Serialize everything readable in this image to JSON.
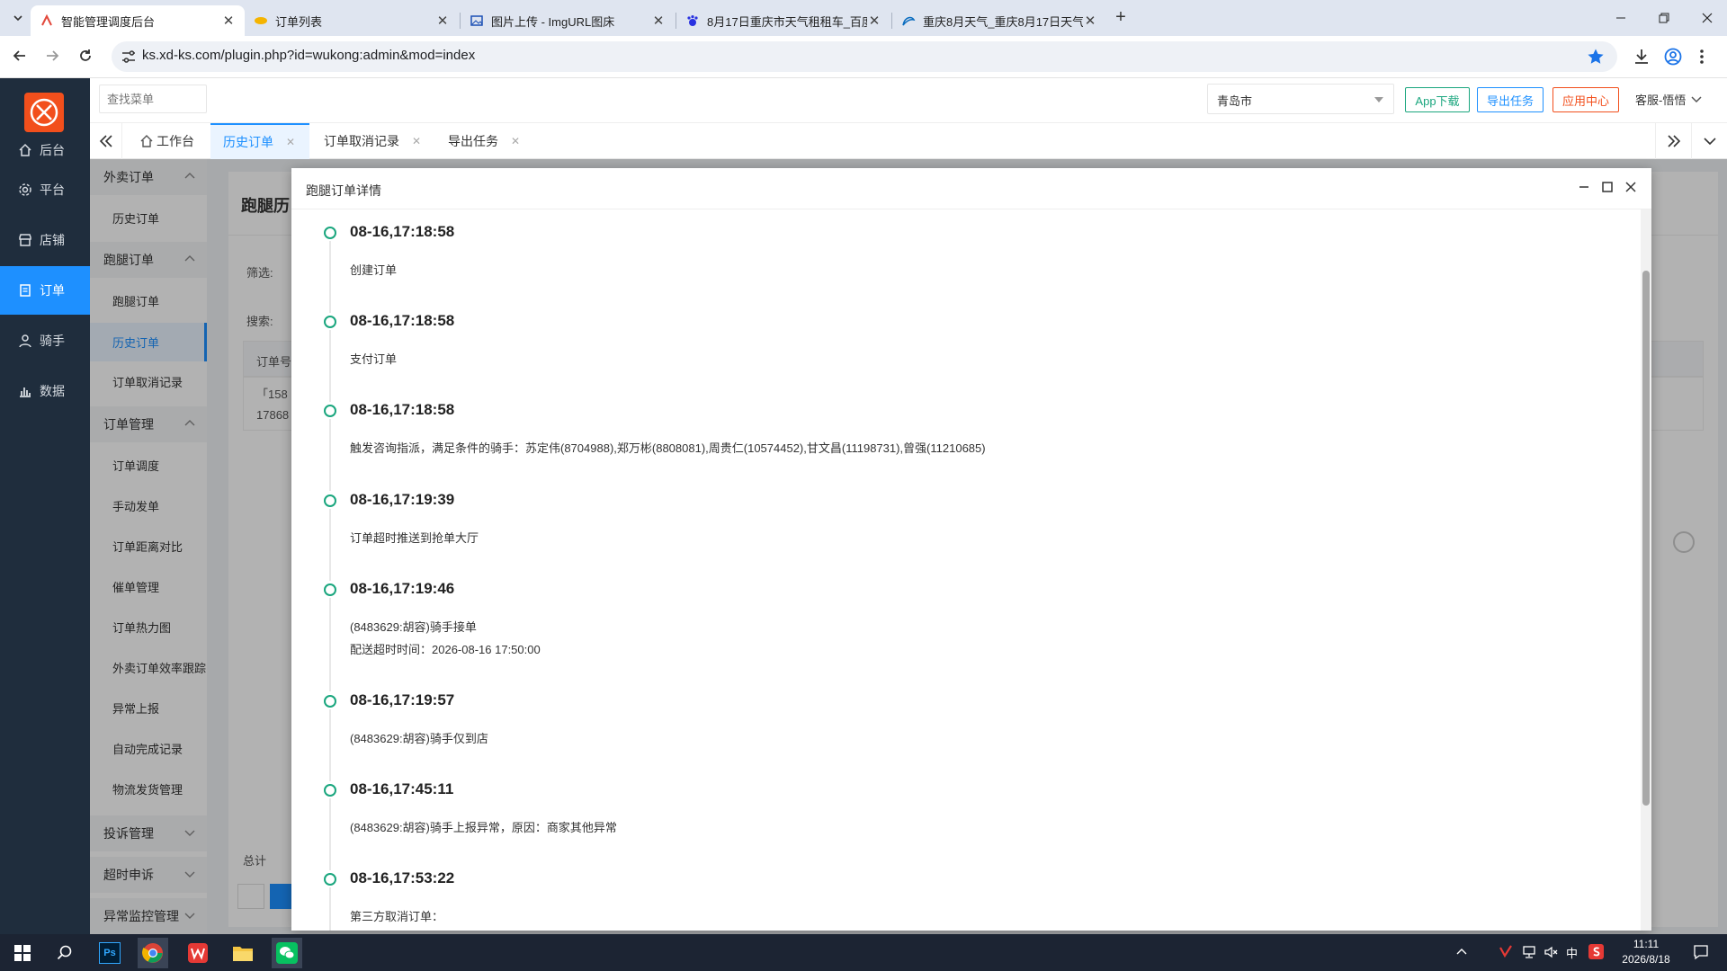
{
  "browser": {
    "tabs": [
      {
        "title": "智能管理调度后台",
        "active": true
      },
      {
        "title": "订单列表",
        "active": false
      },
      {
        "title": "图片上传 - ImgURL图床",
        "active": false
      },
      {
        "title": "8月17日重庆市天气租租车_百度",
        "active": false
      },
      {
        "title": "重庆8月天气_重庆8月17日天气",
        "active": false
      }
    ],
    "url": "ks.xd-ks.com/plugin.php?id=wukong:admin&mod=index"
  },
  "rail": {
    "items": [
      {
        "label": "后台",
        "icon": "home-icon"
      },
      {
        "label": "平台",
        "icon": "gear-icon"
      },
      {
        "label": "店铺",
        "icon": "store-icon"
      },
      {
        "label": "订单",
        "icon": "document-icon",
        "active": true
      },
      {
        "label": "骑手",
        "icon": "user-icon"
      },
      {
        "label": "数据",
        "icon": "bar-chart-icon"
      }
    ]
  },
  "topbar": {
    "search_placeholder": "查找菜单",
    "city": "青岛市",
    "app_download": "App下载",
    "export_task": "导出任务",
    "app_center": "应用中心",
    "user": "客服-悟悟"
  },
  "page_tabs": [
    {
      "label": "工作台",
      "closable": false
    },
    {
      "label": "历史订单",
      "closable": true,
      "active": true
    },
    {
      "label": "订单取消记录",
      "closable": true
    },
    {
      "label": "导出任务",
      "closable": true
    }
  ],
  "side_menu": {
    "groups": [
      {
        "label": "外卖订单",
        "expanded": true,
        "items": [
          "历史订单"
        ]
      },
      {
        "label": "跑腿订单",
        "expanded": true,
        "items": [
          "跑腿订单",
          "历史订单",
          "订单取消记录"
        ]
      },
      {
        "label": "订单管理",
        "expanded": true,
        "items": [
          "订单调度",
          "手动发单",
          "订单距离对比",
          "催单管理",
          "订单热力图",
          "外卖订单效率跟踪",
          "异常上报",
          "自动完成记录",
          "物流发货管理"
        ]
      },
      {
        "label": "投诉管理",
        "expanded": false,
        "items": []
      },
      {
        "label": "超时申诉",
        "expanded": false,
        "items": []
      },
      {
        "label": "异常监控管理",
        "expanded": false,
        "items": []
      }
    ]
  },
  "background_page": {
    "title": "跑腿历",
    "filter_label": "筛选:",
    "search_label": "搜索:",
    "col_order_no": "订单号",
    "row1_a": "「158",
    "row1_b": "17868",
    "total_label": "总计"
  },
  "modal": {
    "title": "跑腿订单详情",
    "timeline": [
      {
        "time": "08-16,17:18:58",
        "lines": [
          "创建订单"
        ]
      },
      {
        "time": "08-16,17:18:58",
        "lines": [
          "支付订单"
        ]
      },
      {
        "time": "08-16,17:18:58",
        "lines": [
          "触发咨询指派，满足条件的骑手：苏定伟(8704988),郑万彬(8808081),周贵仁(10574452),甘文昌(11198731),曾强(11210685)"
        ]
      },
      {
        "time": "08-16,17:19:39",
        "lines": [
          "订单超时推送到抢单大厅"
        ]
      },
      {
        "time": "08-16,17:19:46",
        "lines": [
          "(8483629:胡容)骑手接单",
          "配送超时时间：2026-08-16 17:50:00"
        ]
      },
      {
        "time": "08-16,17:19:57",
        "lines": [
          "(8483629:胡容)骑手仅到店"
        ]
      },
      {
        "time": "08-16,17:45:11",
        "lines": [
          "(8483629:胡容)骑手上报异常，原因：商家其他异常"
        ]
      },
      {
        "time": "08-16,17:53:22",
        "lines": [
          "第三方取消订单："
        ]
      }
    ]
  },
  "taskbar": {
    "time": "11:11",
    "date": "2026/8/18",
    "ime": "中"
  }
}
